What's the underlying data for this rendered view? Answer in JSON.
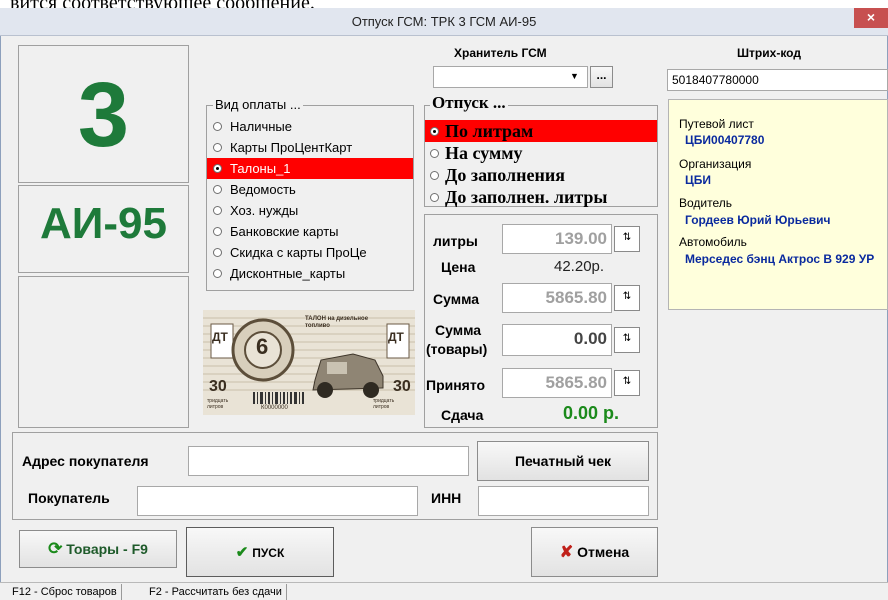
{
  "top_text": "вится соответствующее сообщение.",
  "window": {
    "title": "Отпуск ГСМ:  ТРК 3  ГСМ АИ-95",
    "close_symbol": "×"
  },
  "pump": {
    "number": "3",
    "fuel": "АИ-95"
  },
  "storage": {
    "label": "Хранитель ГСМ",
    "value": "",
    "browse": "..."
  },
  "payment": {
    "title": "Вид оплаты ...",
    "options": [
      "Наличные",
      "Карты ПроЦентКарт",
      "Талоны_1",
      "Ведомость",
      "Хоз. нужды",
      "Банковские карты",
      "Скидка с карты ПроЦе",
      "Дисконтные_карты"
    ],
    "selected": 2
  },
  "dispense": {
    "title": "Отпуск ...",
    "options": [
      "По литрам",
      "На сумму",
      "До заполнения",
      "До заполнен. литры"
    ],
    "selected": 0
  },
  "calc": {
    "liters_label": "литры",
    "liters": "139.00",
    "price_label": "Цена",
    "price": "42.20р.",
    "sum_label": "Сумма",
    "sum": "5865.80",
    "goods_label_1": "Сумма",
    "goods_label_2": "(товары)",
    "goods": "0.00",
    "accepted_label": "Принято",
    "accepted": "5865.80",
    "change_label": "Сдача",
    "change": "0.00 р."
  },
  "coupon": {
    "text": "ТАЛОН на дизельное топливо",
    "badge": "ДТ",
    "number": "6",
    "left_num": "30",
    "right_num": "30",
    "left_small": "тридцать литров",
    "right_small": "тридцать литров",
    "serial": "К0000000"
  },
  "barcode": {
    "label": "Штрих-код",
    "value": "5018407780000"
  },
  "info": {
    "waybill_label": "Путевой лист",
    "waybill": "ЦБИ00407780",
    "org_label": "Организация",
    "org": "ЦБИ",
    "driver_label": "Водитель",
    "driver": "Гордеев Юрий Юрьевич",
    "car_label": "Автомобиль",
    "car": "Мерседес бэнц Актрос В 929 УР"
  },
  "buyer": {
    "address_label": "Адрес покупателя",
    "address": "",
    "buyer_label": "Покупатель",
    "buyer": "",
    "inn_label": "ИНН",
    "inn": "",
    "print_check": "Печатный чек"
  },
  "buttons": {
    "goods": "Товары - F9",
    "start": "ПУСК",
    "cancel": "Отмена"
  },
  "status": {
    "f12": "F12 - Сброс товаров",
    "f2": "F2 - Рассчитать без сдачи"
  },
  "colors": {
    "pump_green": "#1e7a3a",
    "selection_red": "#ff0000",
    "info_blue": "#0a2a9e",
    "change_green": "#1b8a1b"
  }
}
